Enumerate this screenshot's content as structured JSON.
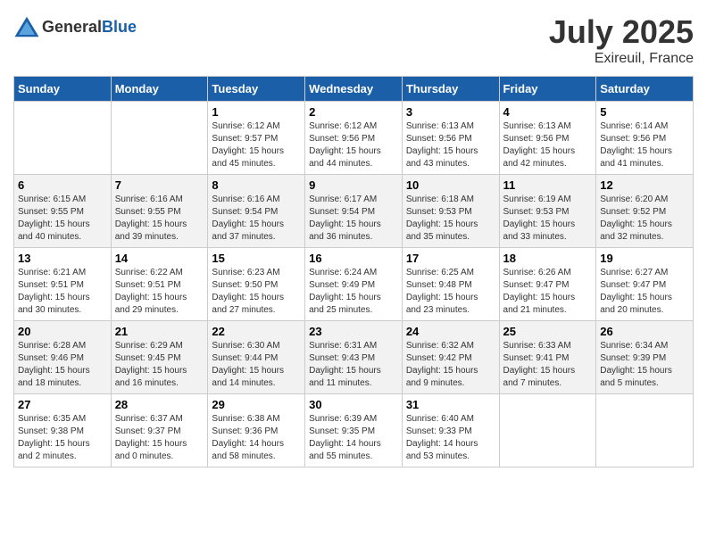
{
  "header": {
    "logo_general": "General",
    "logo_blue": "Blue",
    "month": "July 2025",
    "location": "Exireuil, France"
  },
  "weekdays": [
    "Sunday",
    "Monday",
    "Tuesday",
    "Wednesday",
    "Thursday",
    "Friday",
    "Saturday"
  ],
  "weeks": [
    [
      {
        "day": "",
        "info": ""
      },
      {
        "day": "",
        "info": ""
      },
      {
        "day": "1",
        "info": "Sunrise: 6:12 AM\nSunset: 9:57 PM\nDaylight: 15 hours and 45 minutes."
      },
      {
        "day": "2",
        "info": "Sunrise: 6:12 AM\nSunset: 9:56 PM\nDaylight: 15 hours and 44 minutes."
      },
      {
        "day": "3",
        "info": "Sunrise: 6:13 AM\nSunset: 9:56 PM\nDaylight: 15 hours and 43 minutes."
      },
      {
        "day": "4",
        "info": "Sunrise: 6:13 AM\nSunset: 9:56 PM\nDaylight: 15 hours and 42 minutes."
      },
      {
        "day": "5",
        "info": "Sunrise: 6:14 AM\nSunset: 9:56 PM\nDaylight: 15 hours and 41 minutes."
      }
    ],
    [
      {
        "day": "6",
        "info": "Sunrise: 6:15 AM\nSunset: 9:55 PM\nDaylight: 15 hours and 40 minutes."
      },
      {
        "day": "7",
        "info": "Sunrise: 6:16 AM\nSunset: 9:55 PM\nDaylight: 15 hours and 39 minutes."
      },
      {
        "day": "8",
        "info": "Sunrise: 6:16 AM\nSunset: 9:54 PM\nDaylight: 15 hours and 37 minutes."
      },
      {
        "day": "9",
        "info": "Sunrise: 6:17 AM\nSunset: 9:54 PM\nDaylight: 15 hours and 36 minutes."
      },
      {
        "day": "10",
        "info": "Sunrise: 6:18 AM\nSunset: 9:53 PM\nDaylight: 15 hours and 35 minutes."
      },
      {
        "day": "11",
        "info": "Sunrise: 6:19 AM\nSunset: 9:53 PM\nDaylight: 15 hours and 33 minutes."
      },
      {
        "day": "12",
        "info": "Sunrise: 6:20 AM\nSunset: 9:52 PM\nDaylight: 15 hours and 32 minutes."
      }
    ],
    [
      {
        "day": "13",
        "info": "Sunrise: 6:21 AM\nSunset: 9:51 PM\nDaylight: 15 hours and 30 minutes."
      },
      {
        "day": "14",
        "info": "Sunrise: 6:22 AM\nSunset: 9:51 PM\nDaylight: 15 hours and 29 minutes."
      },
      {
        "day": "15",
        "info": "Sunrise: 6:23 AM\nSunset: 9:50 PM\nDaylight: 15 hours and 27 minutes."
      },
      {
        "day": "16",
        "info": "Sunrise: 6:24 AM\nSunset: 9:49 PM\nDaylight: 15 hours and 25 minutes."
      },
      {
        "day": "17",
        "info": "Sunrise: 6:25 AM\nSunset: 9:48 PM\nDaylight: 15 hours and 23 minutes."
      },
      {
        "day": "18",
        "info": "Sunrise: 6:26 AM\nSunset: 9:47 PM\nDaylight: 15 hours and 21 minutes."
      },
      {
        "day": "19",
        "info": "Sunrise: 6:27 AM\nSunset: 9:47 PM\nDaylight: 15 hours and 20 minutes."
      }
    ],
    [
      {
        "day": "20",
        "info": "Sunrise: 6:28 AM\nSunset: 9:46 PM\nDaylight: 15 hours and 18 minutes."
      },
      {
        "day": "21",
        "info": "Sunrise: 6:29 AM\nSunset: 9:45 PM\nDaylight: 15 hours and 16 minutes."
      },
      {
        "day": "22",
        "info": "Sunrise: 6:30 AM\nSunset: 9:44 PM\nDaylight: 15 hours and 14 minutes."
      },
      {
        "day": "23",
        "info": "Sunrise: 6:31 AM\nSunset: 9:43 PM\nDaylight: 15 hours and 11 minutes."
      },
      {
        "day": "24",
        "info": "Sunrise: 6:32 AM\nSunset: 9:42 PM\nDaylight: 15 hours and 9 minutes."
      },
      {
        "day": "25",
        "info": "Sunrise: 6:33 AM\nSunset: 9:41 PM\nDaylight: 15 hours and 7 minutes."
      },
      {
        "day": "26",
        "info": "Sunrise: 6:34 AM\nSunset: 9:39 PM\nDaylight: 15 hours and 5 minutes."
      }
    ],
    [
      {
        "day": "27",
        "info": "Sunrise: 6:35 AM\nSunset: 9:38 PM\nDaylight: 15 hours and 2 minutes."
      },
      {
        "day": "28",
        "info": "Sunrise: 6:37 AM\nSunset: 9:37 PM\nDaylight: 15 hours and 0 minutes."
      },
      {
        "day": "29",
        "info": "Sunrise: 6:38 AM\nSunset: 9:36 PM\nDaylight: 14 hours and 58 minutes."
      },
      {
        "day": "30",
        "info": "Sunrise: 6:39 AM\nSunset: 9:35 PM\nDaylight: 14 hours and 55 minutes."
      },
      {
        "day": "31",
        "info": "Sunrise: 6:40 AM\nSunset: 9:33 PM\nDaylight: 14 hours and 53 minutes."
      },
      {
        "day": "",
        "info": ""
      },
      {
        "day": "",
        "info": ""
      }
    ]
  ]
}
